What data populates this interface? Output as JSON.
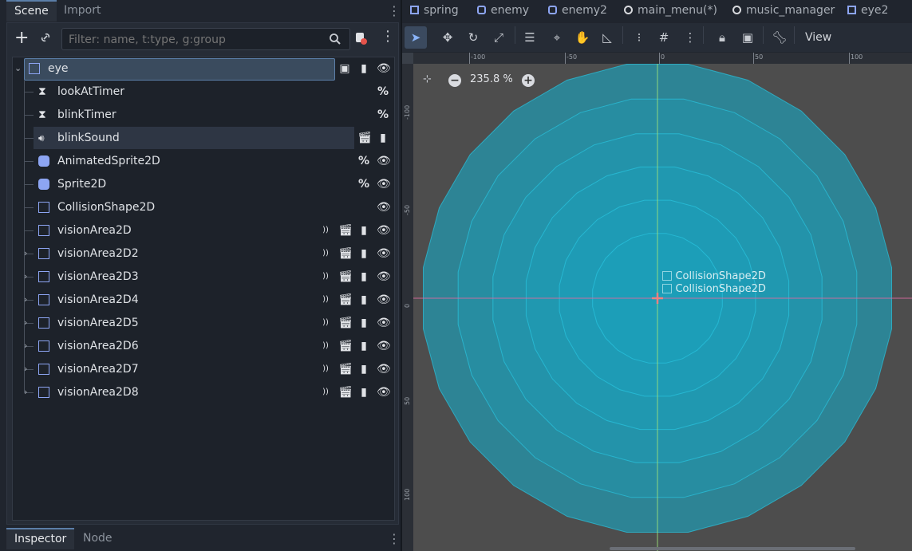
{
  "left_dock": {
    "tabs": [
      "Scene",
      "Import"
    ],
    "filter_placeholder": "Filter: name, t:type, g:group",
    "tree": [
      {
        "name": "eye",
        "icon": "node2d-icon",
        "depth": 0,
        "expandable": true,
        "icons": [
          "group-icon",
          "script-icon",
          "eye-icon"
        ]
      },
      {
        "name": "lookAtTimer",
        "icon": "timer-icon",
        "depth": 1,
        "icons": [
          "percent"
        ]
      },
      {
        "name": "blinkTimer",
        "icon": "timer-icon",
        "depth": 1,
        "icons": [
          "percent"
        ]
      },
      {
        "name": "blinkSound",
        "icon": "audio-icon",
        "depth": 1,
        "icons": [
          "clapper-icon",
          "script-icon"
        ]
      },
      {
        "name": "AnimatedSprite2D",
        "icon": "animated-sprite-icon",
        "depth": 1,
        "icons": [
          "percent",
          "eye-icon"
        ]
      },
      {
        "name": "Sprite2D",
        "icon": "sprite-icon",
        "depth": 1,
        "icons": [
          "percent",
          "eye-icon"
        ]
      },
      {
        "name": "CollisionShape2D",
        "icon": "collision-icon",
        "depth": 1,
        "icons": [
          "eye-icon"
        ]
      },
      {
        "name": "visionArea2D",
        "icon": "area-icon",
        "depth": 1,
        "icons": [
          "signal-icon",
          "clapper-icon",
          "script-icon",
          "eye-icon"
        ]
      },
      {
        "name": "visionArea2D2",
        "icon": "area-icon",
        "depth": 1,
        "expandable": true,
        "icons": [
          "signal-icon",
          "clapper-icon",
          "script-icon",
          "eye-icon"
        ]
      },
      {
        "name": "visionArea2D3",
        "icon": "area-icon",
        "depth": 1,
        "expandable": true,
        "icons": [
          "signal-icon",
          "clapper-icon",
          "script-icon",
          "eye-icon"
        ]
      },
      {
        "name": "visionArea2D4",
        "icon": "area-icon",
        "depth": 1,
        "expandable": true,
        "icons": [
          "signal-icon",
          "clapper-icon",
          "script-icon",
          "eye-icon"
        ]
      },
      {
        "name": "visionArea2D5",
        "icon": "area-icon",
        "depth": 1,
        "expandable": true,
        "icons": [
          "signal-icon",
          "clapper-icon",
          "script-icon",
          "eye-icon"
        ]
      },
      {
        "name": "visionArea2D6",
        "icon": "area-icon",
        "depth": 1,
        "expandable": true,
        "icons": [
          "signal-icon",
          "clapper-icon",
          "script-icon",
          "eye-icon"
        ]
      },
      {
        "name": "visionArea2D7",
        "icon": "area-icon",
        "depth": 1,
        "expandable": true,
        "icons": [
          "signal-icon",
          "clapper-icon",
          "script-icon",
          "eye-icon"
        ]
      },
      {
        "name": "visionArea2D8",
        "icon": "area-icon",
        "depth": 1,
        "expandable": true,
        "icons": [
          "signal-icon",
          "clapper-icon",
          "script-icon",
          "eye-icon"
        ]
      }
    ],
    "bottom_tabs": [
      "Inspector",
      "Node"
    ]
  },
  "editor": {
    "scene_tabs": [
      "spring",
      "enemy",
      "enemy2",
      "main_menu(*)",
      "music_manager",
      "eye2"
    ],
    "view_menu": "View",
    "zoom": "235.8 %",
    "ruler_top": [
      "-100",
      "-50",
      "0",
      "50",
      "100"
    ],
    "ruler_left": [
      "-100",
      "-50",
      "0",
      "50",
      "100"
    ],
    "canvas_labels": [
      "CollisionShape2D",
      "CollisionShape2D"
    ]
  },
  "colors": {
    "accent": "#5b7ea8",
    "area_fill": "#1aa6c2",
    "selected_row": "#34404f"
  }
}
